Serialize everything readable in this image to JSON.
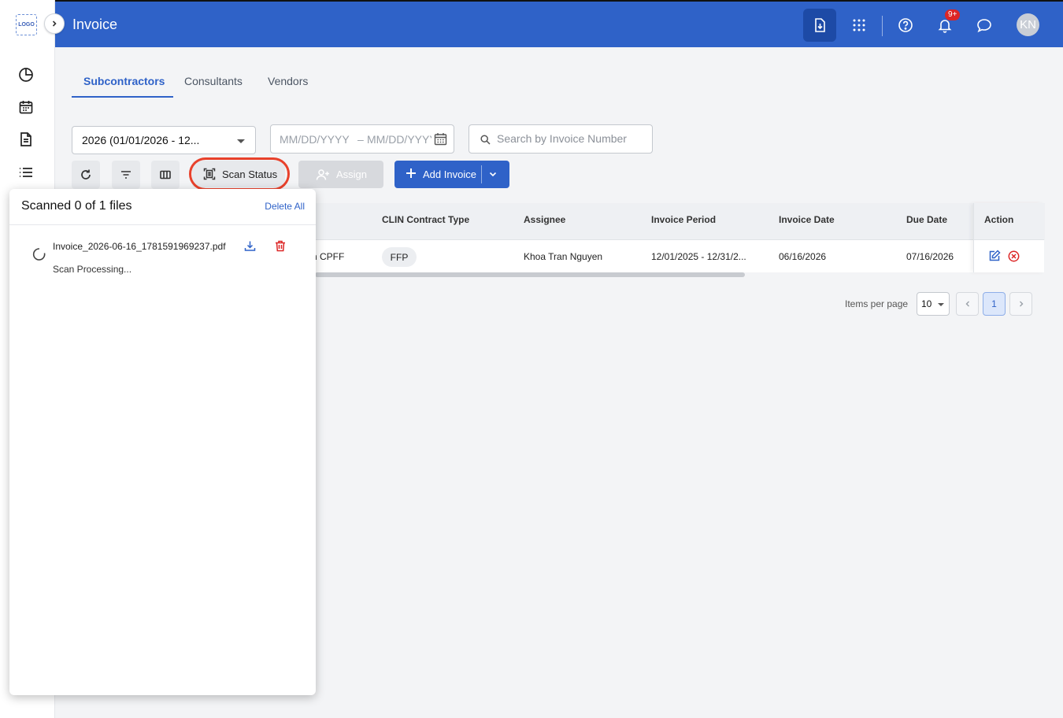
{
  "app": {
    "logo_text": "LOGO",
    "title": "Invoice",
    "notification_badge": "9+",
    "avatar_initials": "KN"
  },
  "tabs": [
    {
      "label": "Subcontractors",
      "active": true
    },
    {
      "label": "Consultants",
      "active": false
    },
    {
      "label": "Vendors",
      "active": false
    }
  ],
  "filters": {
    "period_selected": "2026 (01/01/2026 - 12...",
    "date_start_placeholder": "MM/DD/YYYY",
    "date_separator": "–",
    "date_end_placeholder": "MM/DD/YYYY",
    "search_placeholder": "Search by Invoice Number"
  },
  "toolbar": {
    "scan_status_label": "Scan Status",
    "assign_label": "Assign",
    "add_invoice_label": "Add Invoice"
  },
  "table": {
    "headers": [
      "CLIN Contract Type",
      "Assignee",
      "Invoice Period",
      "Invoice Date",
      "Due Date",
      "Action"
    ],
    "row": {
      "partial_cell": "h CPFF",
      "clin_contract_type": "FFP",
      "assignee": "Khoa Tran Nguyen",
      "invoice_period": "12/01/2025 - 12/31/2...",
      "invoice_date": "06/16/2026",
      "due_date": "07/16/2026"
    }
  },
  "pagination": {
    "items_per_page_label": "Items per page",
    "items_per_page": "10",
    "current_page": "1"
  },
  "scan_panel": {
    "title": "Scanned 0 of 1 files",
    "delete_all_label": "Delete All",
    "file_name": "Invoice_2026-06-16_1781591969237.pdf",
    "file_status": "Scan Processing..."
  },
  "colors": {
    "primary": "#2f62c8",
    "header": "#2f62c8",
    "danger": "#dc2626",
    "highlight_ring": "#e8412b"
  }
}
